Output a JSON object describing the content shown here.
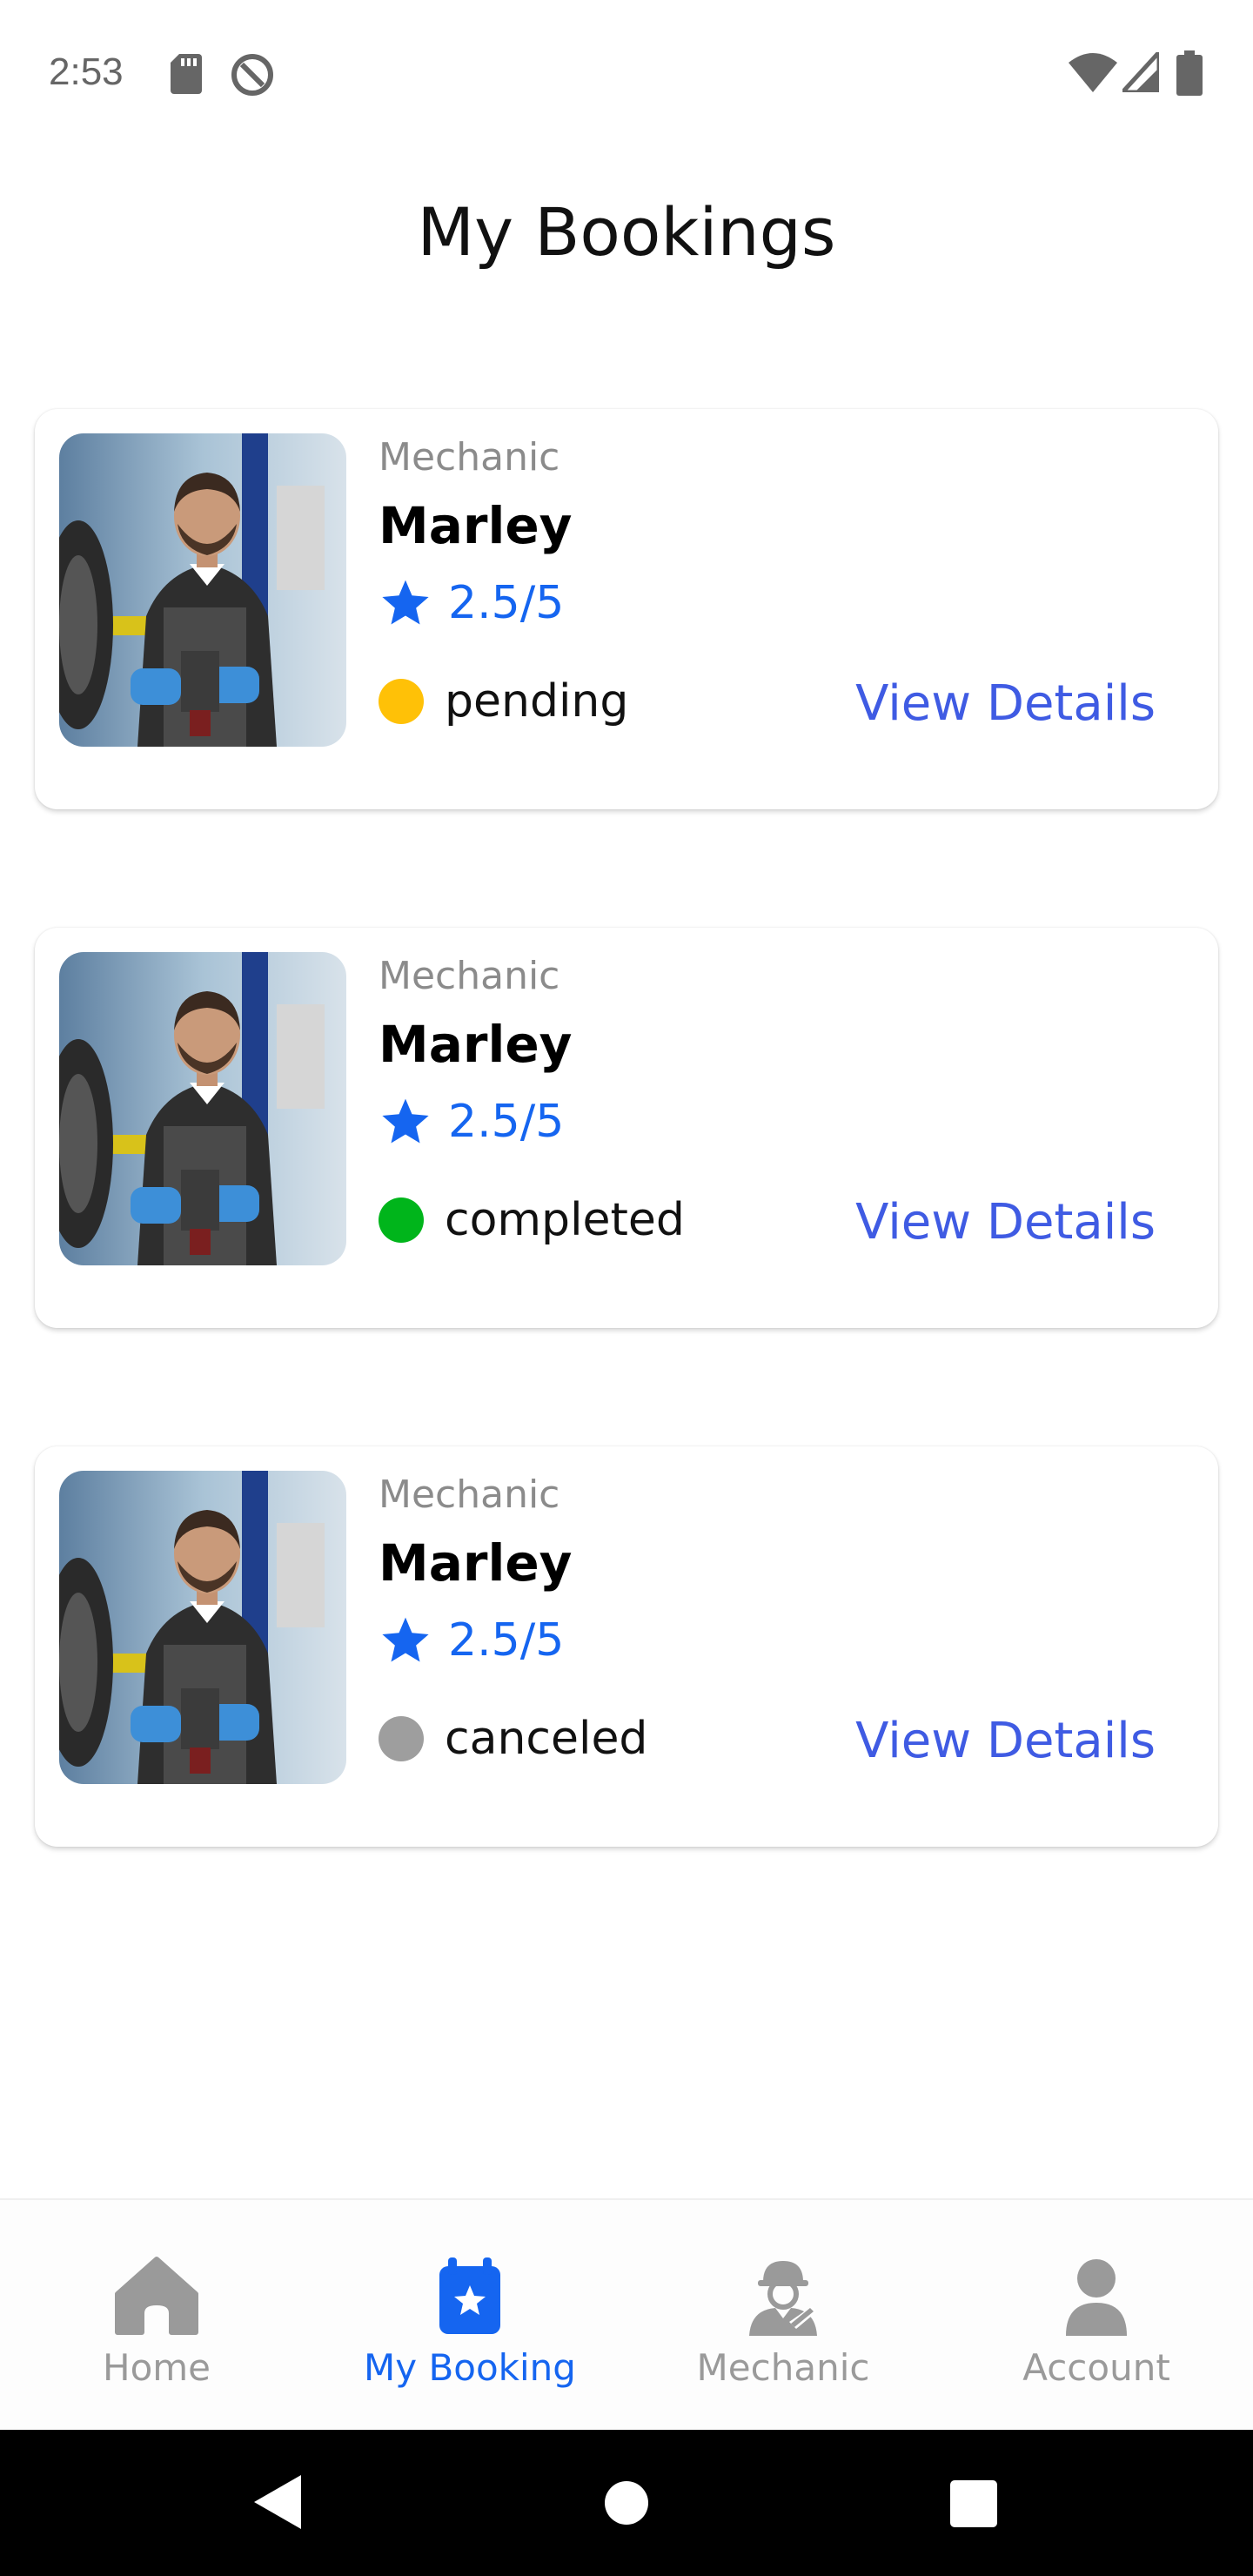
{
  "status_bar": {
    "time": "2:53",
    "icons": [
      "sd-card-icon",
      "data-saver-icon",
      "wifi-icon",
      "signal-icon",
      "battery-icon"
    ]
  },
  "header": {
    "title": "My Bookings"
  },
  "bookings": [
    {
      "role": "Mechanic",
      "name": "Marley",
      "rating": "2.5/5",
      "status": "pending",
      "status_color": "#ffc107",
      "action": "View Details"
    },
    {
      "role": "Mechanic",
      "name": "Marley",
      "rating": "2.5/5",
      "status": "completed",
      "status_color": "#00b51b",
      "action": "View Details"
    },
    {
      "role": "Mechanic",
      "name": "Marley",
      "rating": "2.5/5",
      "status": "canceled",
      "status_color": "#9e9e9e",
      "action": "View Details"
    }
  ],
  "bottom_nav": {
    "items": [
      {
        "label": "Home",
        "icon": "home-icon",
        "active": false
      },
      {
        "label": "My Booking",
        "icon": "calendar-star-icon",
        "active": true
      },
      {
        "label": "Mechanic",
        "icon": "mechanic-icon",
        "active": false
      },
      {
        "label": "Account",
        "icon": "person-icon",
        "active": false
      }
    ]
  },
  "colors": {
    "accent": "#1565f0",
    "link": "#3f5be3",
    "inactive": "#9a9a9a"
  },
  "system_nav": {
    "icons": [
      "back-icon",
      "home-circle-icon",
      "recents-icon"
    ]
  }
}
